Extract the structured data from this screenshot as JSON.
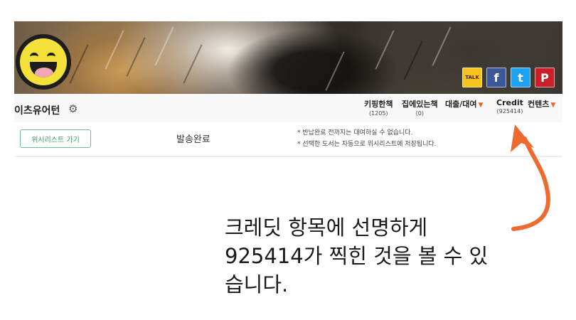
{
  "header": {
    "site_title": "이츠유어턴",
    "social": {
      "kakao_label": "TALK",
      "facebook_label": "f",
      "twitter_label": "t",
      "pinterest_label": "P"
    }
  },
  "nav": {
    "keeping": {
      "label": "키핑한책",
      "count": "(1205)"
    },
    "home": {
      "label": "집에있는책",
      "count": "(0)"
    },
    "rental": {
      "label": "대출/대여"
    },
    "credit": {
      "label": "Credit",
      "count": "(925414)"
    },
    "contents": {
      "label": "컨텐츠"
    }
  },
  "message": {
    "wishlist_button": "위시리스트 가기",
    "status": "발송완료",
    "notes": [
      "* 반납완료 전까지는 대여하실 수 없습니다.",
      "* 선택한 도서는 자동으로 위시리스트에 저장됩니다."
    ]
  },
  "annotation": {
    "caption_line1": "크레딧 항목에 선명하게",
    "caption_line2": "925414가 찍힌 것을 볼 수 있",
    "caption_line3": "습니다.",
    "arrow_color": "#ee6a2e"
  }
}
